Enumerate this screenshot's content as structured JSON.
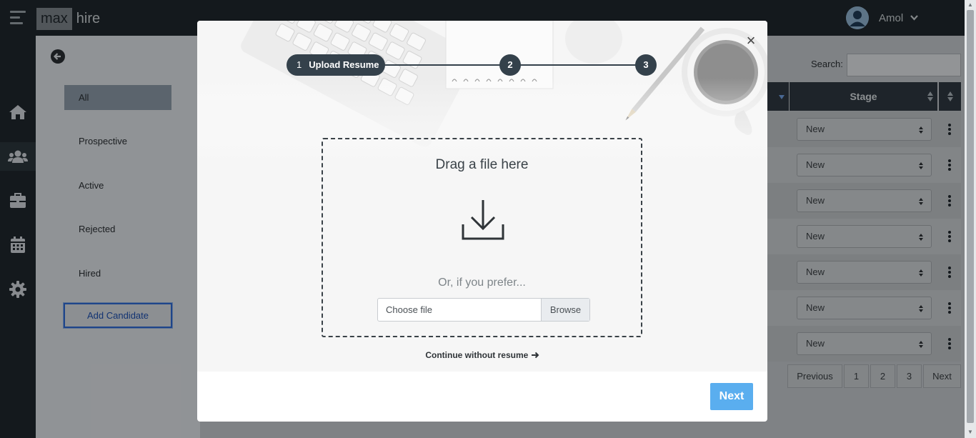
{
  "app": {
    "logo_part1": "max",
    "logo_part2": "hire"
  },
  "user": {
    "name": "Amol"
  },
  "sidebar": {
    "icons": [
      "home-icon",
      "users-icon",
      "briefcase-icon",
      "calendar-icon",
      "gear-icon"
    ],
    "active": "users-icon"
  },
  "filters": {
    "items": [
      {
        "label": "All",
        "active": true
      },
      {
        "label": "Prospective",
        "active": false
      },
      {
        "label": "Active",
        "active": false
      },
      {
        "label": "Rejected",
        "active": false
      },
      {
        "label": "Hired",
        "active": false
      }
    ],
    "add_candidate_label": "Add Candidate"
  },
  "table": {
    "search_label": "Search:",
    "stage_header": "Stage",
    "rows": [
      {
        "stage": "New"
      },
      {
        "stage": "New"
      },
      {
        "stage": "New"
      },
      {
        "stage": "New"
      },
      {
        "stage": "New"
      },
      {
        "stage": "New"
      },
      {
        "stage": "New"
      }
    ],
    "pagination": {
      "previous": "Previous",
      "pages": [
        "1",
        "2",
        "3"
      ],
      "next": "Next"
    }
  },
  "modal": {
    "steps": [
      {
        "number": "1",
        "label": "Upload Resume",
        "active": true
      },
      {
        "number": "2",
        "label": "",
        "active": false
      },
      {
        "number": "3",
        "label": "",
        "active": false
      }
    ],
    "close_symbol": "×",
    "drop_title": "Drag a file here",
    "prefer_text": "Or, if you prefer...",
    "file_placeholder": "Choose file",
    "browse_label": "Browse",
    "continue_label": "Continue without resume",
    "next_label": "Next"
  },
  "colors": {
    "dark": "#1f272d",
    "stepper": "#34414b",
    "accent": "#5aaeef",
    "filter_active": "#8c9aa8"
  }
}
